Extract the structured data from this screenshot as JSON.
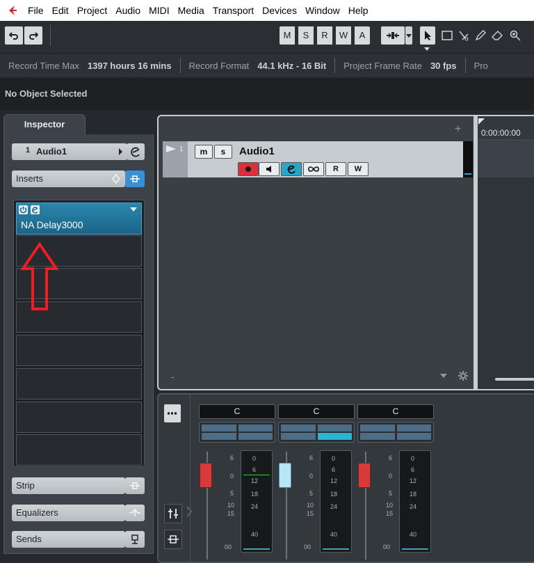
{
  "menu": {
    "items": [
      "File",
      "Edit",
      "Project",
      "Audio",
      "MIDI",
      "Media",
      "Transport",
      "Devices",
      "Window",
      "Help"
    ],
    "logo_color": "#d8232a"
  },
  "toolbar": {
    "undo_icon": "undo-icon",
    "redo_icon": "redo-icon",
    "automation_modes": [
      "M",
      "S",
      "R",
      "W",
      "A"
    ],
    "tools": [
      "arrow-icon",
      "range-icon",
      "split-icon",
      "pencil-icon",
      "eraser-icon",
      "zoom-icon"
    ]
  },
  "infobar": {
    "record_time_label": "Record Time Max",
    "record_time_value": "1397 hours 16 mins",
    "record_format_label": "Record Format",
    "record_format_value": "44.1 kHz - 16 Bit",
    "frame_rate_label": "Project Frame Rate",
    "frame_rate_value": "30 fps",
    "pan_label": "Pro"
  },
  "status": {
    "text": "No Object Selected"
  },
  "inspector": {
    "tab_label": "Inspector",
    "track_number": "1",
    "track_name": "Audio1",
    "inserts_label": "Inserts",
    "plugin_name": "NA Delay3000",
    "strip_label": "Strip",
    "equalizers_label": "Equalizers",
    "sends_label": "Sends"
  },
  "project": {
    "track_number": "1",
    "track_name": "Audio1",
    "mute_label": "m",
    "solo_label": "s",
    "read_label": "R",
    "write_label": "W",
    "timecode": "0:00:00:00",
    "add_icon": "+",
    "minus_icon": "-",
    "record_color": "#e0323c",
    "edit_accent": "#1e9fc0"
  },
  "mixer": {
    "channel_pan_label": "C",
    "scale_left": [
      "6",
      "0",
      "5",
      "10",
      "15",
      "00"
    ],
    "scale_right": [
      "0",
      "6",
      "12",
      "18",
      "24",
      "40"
    ],
    "fader_colors": [
      "#d83a3a",
      "#b9e6f5",
      "#d83a3a"
    ]
  }
}
